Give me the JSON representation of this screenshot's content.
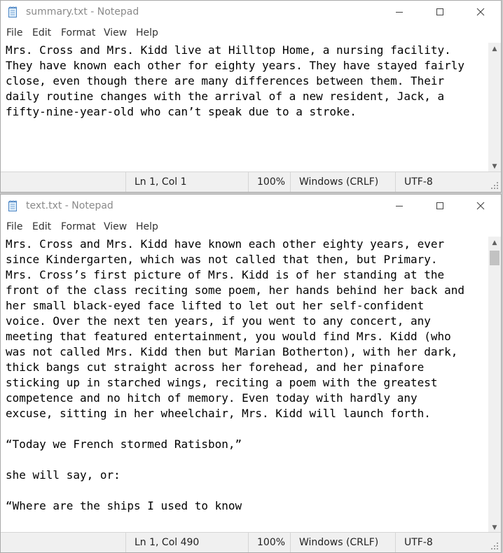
{
  "windows": [
    {
      "title": "summary.txt - Notepad",
      "menu": [
        "File",
        "Edit",
        "Format",
        "View",
        "Help"
      ],
      "content": "Mrs. Cross and Mrs. Kidd live at Hilltop Home, a nursing facility.\nThey have known each other for eighty years. They have stayed fairly\nclose, even though there are many differences between them. Their\ndaily routine changes with the arrival of a new resident, Jack, a\nfifty-nine-year-old who can’t speak due to a stroke.",
      "status": {
        "position": "Ln 1, Col 1",
        "zoom": "100%",
        "line_ending": "Windows (CRLF)",
        "encoding": "UTF-8"
      }
    },
    {
      "title": "text.txt - Notepad",
      "menu": [
        "File",
        "Edit",
        "Format",
        "View",
        "Help"
      ],
      "content": "Mrs. Cross and Mrs. Kidd have known each other eighty years, ever\nsince Kindergarten, which was not called that then, but Primary.\nMrs. Cross’s first picture of Mrs. Kidd is of her standing at the\nfront of the class reciting some poem, her hands behind her back and\nher small black-eyed face lifted to let out her self-confident\nvoice. Over the next ten years, if you went to any concert, any\nmeeting that featured entertainment, you would find Mrs. Kidd (who\nwas not called Mrs. Kidd then but Marian Botherton), with her dark,\nthick bangs cut straight across her forehead, and her pinafore\nsticking up in starched wings, reciting a poem with the greatest\ncompetence and no hitch of memory. Even today with hardly any\nexcuse, sitting in her wheelchair, Mrs. Kidd will launch forth.\n\n“Today we French stormed Ratisbon,”\n\nshe will say, or:\n\n“Where are the ships I used to know\n\nThat came to port on the Fundy tide?”",
      "status": {
        "position": "Ln 1, Col 490",
        "zoom": "100%",
        "line_ending": "Windows (CRLF)",
        "encoding": "UTF-8"
      }
    }
  ]
}
